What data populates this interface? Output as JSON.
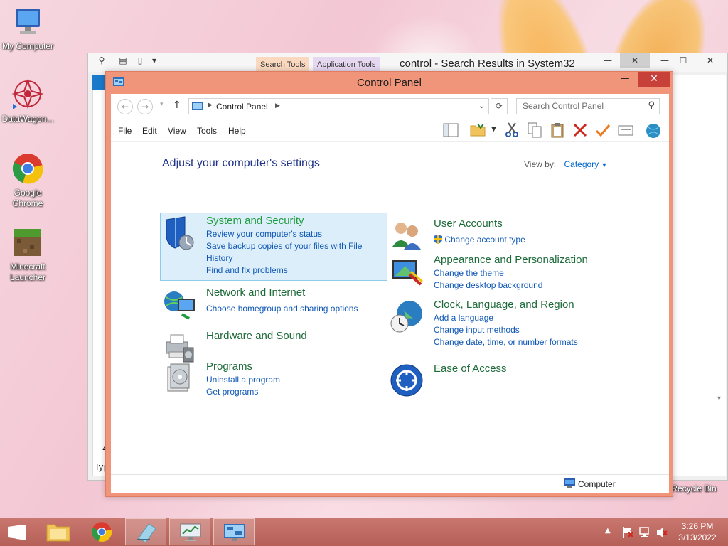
{
  "desktop": {
    "icons": [
      {
        "label": "My Computer",
        "icon": "computer-icon"
      },
      {
        "label": "DataWagon...",
        "icon": "datawagon-icon"
      },
      {
        "label": "Google Chrome",
        "icon": "chrome-icon"
      },
      {
        "label": "Minecraft Launcher",
        "icon": "minecraft-icon"
      },
      {
        "label": "Recycle Bin",
        "icon": "recycle-bin-icon"
      }
    ]
  },
  "back_window": {
    "title": "control - Search Results in System32",
    "ribbon_tabs": [
      "Search Tools",
      "Application Tools"
    ],
    "partial_left_text": [
      "4",
      "Typ"
    ]
  },
  "window": {
    "title": "Control Panel",
    "address": {
      "location": "Control Panel"
    },
    "search": {
      "placeholder": "Search Control Panel"
    },
    "menu": [
      "File",
      "Edit",
      "View",
      "Tools",
      "Help"
    ],
    "heading": "Adjust your computer's settings",
    "view_by": {
      "label": "View by:",
      "value": "Category"
    },
    "categories_left": [
      {
        "title": "System and Security",
        "icon": "shield-icon",
        "links": [
          "Review your computer's status",
          "Save backup copies of your files with File History",
          "Find and fix problems"
        ],
        "highlighted": true
      },
      {
        "title": "Network and Internet",
        "icon": "network-icon",
        "links": [
          "Choose homegroup and sharing options"
        ]
      },
      {
        "title": "Hardware and Sound",
        "icon": "printer-icon",
        "links": []
      },
      {
        "title": "Programs",
        "icon": "programs-icon",
        "links": [
          "Uninstall a program",
          "Get programs"
        ]
      }
    ],
    "categories_right": [
      {
        "title": "User Accounts",
        "icon": "users-icon",
        "links": [
          "Change account type"
        ]
      },
      {
        "title": "Appearance and Personalization",
        "icon": "display-icon",
        "links": [
          "Change the theme",
          "Change desktop background"
        ]
      },
      {
        "title": "Clock, Language, and Region",
        "icon": "globe-clock-icon",
        "links": [
          "Add a language",
          "Change input methods",
          "Change date, time, or number formats"
        ]
      },
      {
        "title": "Ease of Access",
        "icon": "ease-of-access-icon",
        "links": []
      }
    ],
    "status": "Computer"
  },
  "taskbar": {
    "time": "3:26 PM",
    "date": "3/13/2022"
  },
  "colors": {
    "accent": "#f0957a",
    "close": "#c7413a",
    "link": "#0f57b5",
    "category_title": "#1e6b3a",
    "heading": "#1e3287"
  }
}
